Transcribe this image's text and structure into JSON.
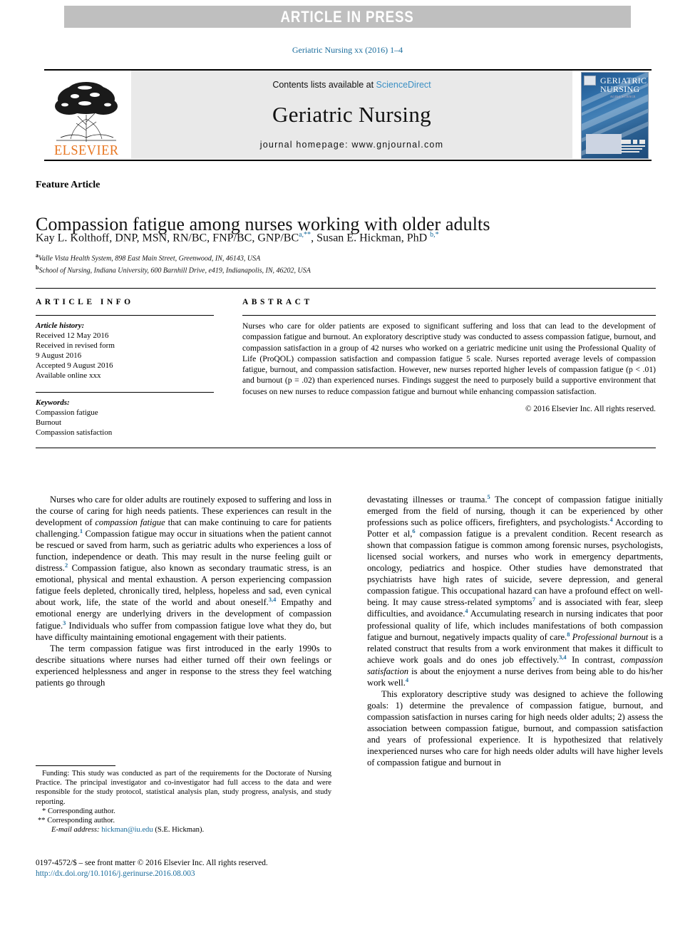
{
  "banner": {
    "text": "ARTICLE IN PRESS"
  },
  "running_head": {
    "text": "Geriatric Nursing xx (2016) 1–4"
  },
  "masthead": {
    "contents_prefix": "Contents lists available at ",
    "sciencedirect": "ScienceDirect",
    "journal_name": "Geriatric Nursing",
    "homepage": "journal homepage: www.gnjournal.com",
    "publisher": "ELSEVIER",
    "cover": {
      "line1": "GERIATRIC",
      "line2": "NURSING",
      "subtitle": "AGING SCIENCE"
    }
  },
  "article": {
    "section_label": "Feature Article",
    "title": "Compassion fatigue among nurses working with older adults",
    "authors": [
      {
        "name": "Kay L. Kolthoff, DNP, MSN, RN/BC, FNP/BC, GNP/BC",
        "marks": "a,**"
      },
      {
        "name": "Susan E. Hickman, PhD",
        "marks": "b,*"
      }
    ],
    "affiliations": [
      {
        "mark": "a",
        "text": "Valle Vista Health System, 898 East Main Street, Greenwood, IN, 46143, USA"
      },
      {
        "mark": "b",
        "text": "School of Nursing, Indiana University, 600 Barnhill Drive, e419, Indianapolis, IN, 46202, USA"
      }
    ]
  },
  "article_info": {
    "heading": "ARTICLE INFO",
    "history_label": "Article history:",
    "history": [
      "Received 12 May 2016",
      "Received in revised form",
      "9 August 2016",
      "Accepted 9 August 2016",
      "Available online xxx"
    ],
    "keywords_label": "Keywords:",
    "keywords": [
      "Compassion fatigue",
      "Burnout",
      "Compassion satisfaction"
    ]
  },
  "abstract": {
    "heading": "ABSTRACT",
    "text": "Nurses who care for older patients are exposed to significant suffering and loss that can lead to the development of compassion fatigue and burnout. An exploratory descriptive study was conducted to assess compassion fatigue, burnout, and compassion satisfaction in a group of 42 nurses who worked on a geriatric medicine unit using the Professional Quality of Life (ProQOL) compassion satisfaction and compassion fatigue 5 scale. Nurses reported average levels of compassion fatigue, burnout, and compassion satisfaction. However, new nurses reported higher levels of compassion fatigue (p < .01) and burnout (p = .02) than experienced nurses. Findings suggest the need to purposely build a supportive environment that focuses on new nurses to reduce compassion fatigue and burnout while enhancing compassion satisfaction.",
    "copyright": "© 2016 Elsevier Inc. All rights reserved."
  },
  "body": {
    "left": {
      "p1_a": "Nurses who care for older adults are routinely exposed to suffering and loss in the course of caring for high needs patients. These experiences can result in the development of ",
      "p1_i1": "compassion fatigue",
      "p1_b": " that can make continuing to care for patients challenging.",
      "p1_r1": "1",
      "p1_c": " Compassion fatigue may occur in situations when the patient cannot be rescued or saved from harm, such as geriatric adults who experiences a loss of function, independence or death. This may result in the nurse feeling guilt or distress.",
      "p1_r2": "2",
      "p1_d": " Compassion fatigue, also known as secondary traumatic stress, is an emotional, physical and mental exhaustion. A person experiencing compassion fatigue feels depleted, chronically tired, helpless, hopeless and sad, even cynical about work, life, the state of the world and about oneself.",
      "p1_r3": "3,4",
      "p1_e": " Empathy and emotional energy are underlying drivers in the development of compassion fatigue.",
      "p1_r4": "3",
      "p1_f": " Individuals who suffer from compassion fatigue love what they do, but have difficulty maintaining emotional engagement with their patients.",
      "p2": "The term compassion fatigue was first introduced in the early 1990s to describe situations where nurses had either turned off their own feelings or experienced helplessness and anger in response to the stress they feel watching patients go through"
    },
    "right": {
      "p1_a": "devastating illnesses or trauma.",
      "p1_r1": "5",
      "p1_b": " The concept of compassion fatigue initially emerged from the field of nursing, though it can be experienced by other professions such as police officers, firefighters, and psychologists.",
      "p1_r2": "4",
      "p1_c": " According to Potter et al,",
      "p1_r3": "6",
      "p1_d": " compassion fatigue is a prevalent condition. Recent research as shown that compassion fatigue is common among forensic nurses, psychologists, licensed social workers, and nurses who work in emergency departments, oncology, pediatrics and hospice. Other studies have demonstrated that psychiatrists have high rates of suicide, severe depression, and general compassion fatigue. This occupational hazard can have a profound effect on well-being. It may cause stress-related symptoms",
      "p1_r4": "7",
      "p1_e": " and is associated with fear, sleep difficulties, and avoidance.",
      "p1_r5": "4",
      "p1_f": " Accumulating research in nursing indicates that poor professional quality of life, which includes manifestations of both compassion fatigue and burnout, negatively impacts quality of care.",
      "p1_r6": "8",
      "p1_i1": " Professional burnout",
      "p1_g": " is a related construct that results from a work environment that makes it difficult to achieve work goals and do ones job effectively.",
      "p1_r7": "3,4",
      "p1_h": " In contrast, ",
      "p1_i2": "compassion satisfaction",
      "p1_j": " is about the enjoyment a nurse derives from being able to do his/her work well.",
      "p1_r8": "4",
      "p2": "This exploratory descriptive study was designed to achieve the following goals: 1) determine the prevalence of compassion fatigue, burnout, and compassion satisfaction in nurses caring for high needs older adults; 2) assess the association between compassion fatigue, burnout, and compassion satisfaction and years of professional experience. It is hypothesized that relatively inexperienced nurses who care for high needs older adults will have higher levels of compassion fatigue and burnout in"
    }
  },
  "footnotes": {
    "funding": "Funding: This study was conducted as part of the requirements for the Doctorate of Nursing Practice. The principal investigator and co-investigator had full access to the data and were responsible for the study protocol, statistical analysis plan, study progress, analysis, and study reporting.",
    "corresponding_1": "* Corresponding author.",
    "corresponding_2": "** Corresponding author.",
    "email_label": "E-mail address:",
    "email": "hickman@iu.edu",
    "email_owner": "(S.E. Hickman)."
  },
  "imprint": {
    "issn_line": "0197-4572/$ – see front matter © 2016 Elsevier Inc. All rights reserved.",
    "doi": "http://dx.doi.org/10.1016/j.gerinurse.2016.08.003"
  }
}
